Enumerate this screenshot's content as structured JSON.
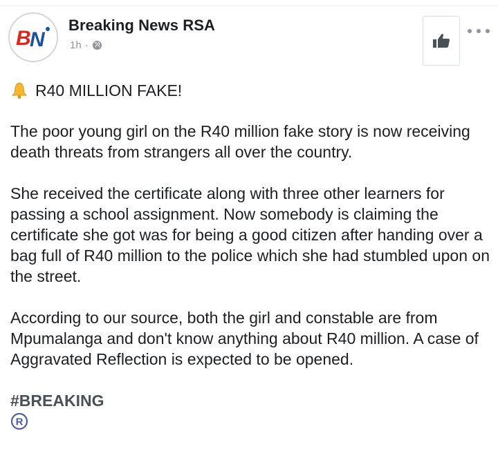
{
  "post": {
    "page_name": "Breaking News RSA",
    "timestamp": "1h",
    "meta_separator": "·",
    "privacy_icon": "globe-icon",
    "avatar_text": "BN",
    "like_icon": "thumbs-up-icon",
    "more_icon": "more-dots-icon",
    "headline_icon": "bell-icon",
    "headline": "R40 MILLION FAKE!",
    "paragraphs": [
      "The poor young girl on the R40 million fake story is now receiving death threats from strangers all over the country.",
      "She received the certificate along with three other learners for passing a school assignment. Now somebody is claiming the certificate she got was for being a good citizen after handing over a bag full of R40 million to the police which she had stumbled upon on the street.",
      "According to our source, both the girl and constable are from Mpumalanga and don't know anything about R40 million. A case of Aggravated Reflection is expected to be opened."
    ],
    "hashtag": "#BREAKING",
    "footer_symbol": "®"
  },
  "colors": {
    "text": "#1c1e21",
    "meta": "#90949c",
    "hashtag": "#4b4f56",
    "logo_red": "#e2231a",
    "logo_blue": "#1d4fa3",
    "footer_symbol": "#4b5fa0"
  }
}
